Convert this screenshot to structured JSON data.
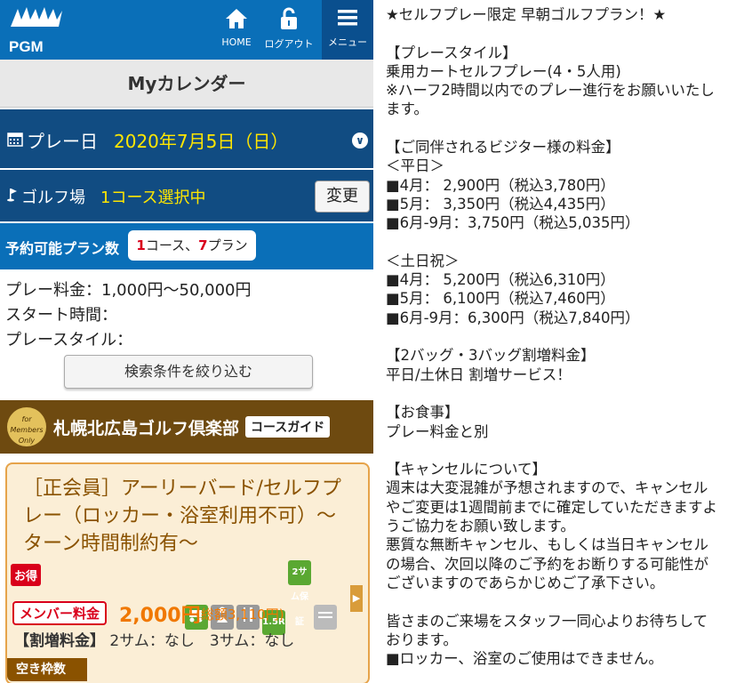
{
  "header": {
    "logo": "PGM",
    "home_label": "HOME",
    "logout_label": "ログアウト",
    "menu_label": "メニュー"
  },
  "mycalendar": "Myカレンダー",
  "play_day": {
    "label": "プレー日",
    "value": "2020年7月5日（日）"
  },
  "golf_course": {
    "label": "ゴルフ場",
    "selection": "1コース選択中",
    "change_button": "変更"
  },
  "available": {
    "label": "予約可能プラン数",
    "courses_count": "1",
    "courses_suffix": "コース、",
    "plans_count": "7",
    "plans_suffix": "プラン"
  },
  "conditions": {
    "fee": "プレー料金：1,000円〜50,000円",
    "start_time": "スタート時間：",
    "play_style": "プレースタイル：",
    "narrow_button": "検索条件を絞り込む"
  },
  "club": {
    "badge": "for Members Only",
    "name": "札幌北広島ゴルフ倶楽部",
    "guide_button": "コースガイド"
  },
  "plan": {
    "title": "［正会員］アーリーバード/セルフプレー（ロッカー・浴室利用不可）〜ターン時間制約有〜",
    "deal": "お得",
    "icons": [
      "cart-icon",
      "caddie-icon",
      "meal-icon",
      "holes-icon",
      "two-some-guarantee-icon",
      "tee-icon"
    ],
    "icon_texts": [
      "",
      "",
      "",
      "1.5R",
      "2サム保証",
      ""
    ],
    "member_label": "メンバー料金",
    "price": "2,000円",
    "total": "(総額3,110円)",
    "extra_label": "【割増料金】",
    "extra_value": "2サム：なし　3サム：なし",
    "slots_label": "空き枠数"
  },
  "details": [
    "★セルフプレー限定 早朝ゴルフプラン！★",
    "",
    "【プレースタイル】",
    "乗用カートセルフプレー(4・5人用)",
    "※ハーフ2時間以内でのプレー進行をお願いいたし",
    "ます。",
    "",
    "【ご同伴されるビジター様の料金】",
    "＜平日＞",
    "■4月： 2,900円（税込3,780円）",
    "■5月： 3,350円（税込4,435円）",
    "■6月-9月：3,750円（税込5,035円）",
    "",
    "＜土日祝＞",
    "■4月： 5,200円（税込6,310円）",
    "■5月： 6,100円（税込7,460円）",
    "■6月-9月：6,300円（税込7,840円）",
    "",
    "【2バッグ・3バッグ割増料金】",
    "平日/土休日 割増サービス！",
    "",
    "【お食事】",
    "プレー料金と別",
    "",
    "【キャンセルについて】",
    "週末は大変混雑が予想されますので、キャンセル",
    "やご変更は1週間前までに確定していただきますよ",
    "うご協力をお願い致します。",
    "悪質な無断キャンセル、もしくは当日キャンセル",
    "の場合、次回以降のご予約をお断りする可能性が",
    "ございますのであらかじめご了承下さい。",
    "",
    "皆さまのご来場をスタッフ一同心よりお待ちして",
    "おります。",
    "■ロッカー、浴室のご使用はできません。"
  ],
  "colors": {
    "brand_blue": "#0a6fb8",
    "dark_blue": "#114c82",
    "highlight_yellow": "#ffe600",
    "club_brown": "#6e4a10",
    "price_orange": "#f07800",
    "alert_red": "#d9001b"
  }
}
